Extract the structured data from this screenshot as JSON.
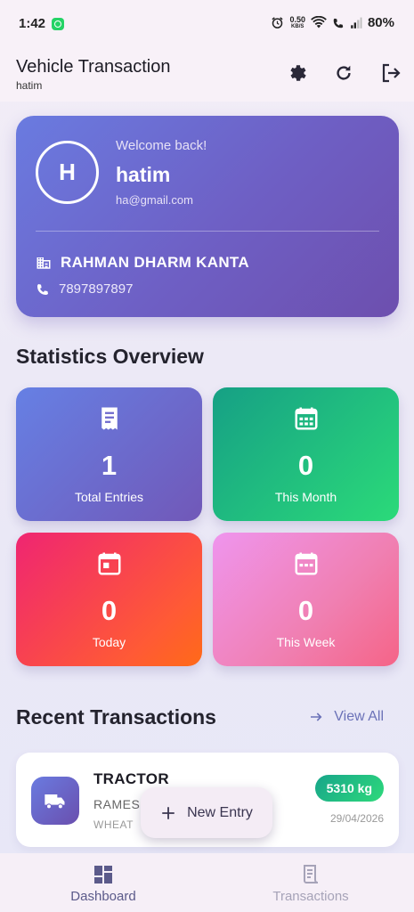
{
  "status_bar": {
    "time": "1:42",
    "net_speed_value": "0.50",
    "net_speed_unit": "KB/S",
    "battery": "80%"
  },
  "app_bar": {
    "title": "Vehicle Transaction",
    "subtitle": "hatim",
    "icons": [
      "settings-icon",
      "refresh-icon",
      "logout-icon"
    ]
  },
  "profile": {
    "avatar_initial": "H",
    "welcome": "Welcome back!",
    "name": "hatim",
    "email": "ha@gmail.com",
    "company": "RAHMAN DHARM KANTA",
    "phone": "7897897897"
  },
  "statistics": {
    "title": "Statistics Overview",
    "cards": [
      {
        "value": "1",
        "label": "Total Entries",
        "icon": "receipt-icon"
      },
      {
        "value": "0",
        "label": "This Month",
        "icon": "calendar-month-icon"
      },
      {
        "value": "0",
        "label": "Today",
        "icon": "calendar-today-icon"
      },
      {
        "value": "0",
        "label": "This Week",
        "icon": "calendar-week-icon"
      }
    ]
  },
  "recent": {
    "title": "Recent Transactions",
    "view_all": "View All",
    "transactions": [
      {
        "vehicle": "TRACTOR",
        "party": "RAMES",
        "item": "WHEAT",
        "weight": "5310 kg",
        "date": "29/04/2026"
      }
    ]
  },
  "fab": {
    "label": "New Entry"
  },
  "bottom_nav": {
    "items": [
      {
        "label": "Dashboard",
        "active": true
      },
      {
        "label": "Transactions",
        "active": false
      }
    ]
  },
  "colors": {
    "primary": "#6e5fc4",
    "green": "#2bda79",
    "red": "#ff5a35",
    "pink": "#f07fb1"
  }
}
